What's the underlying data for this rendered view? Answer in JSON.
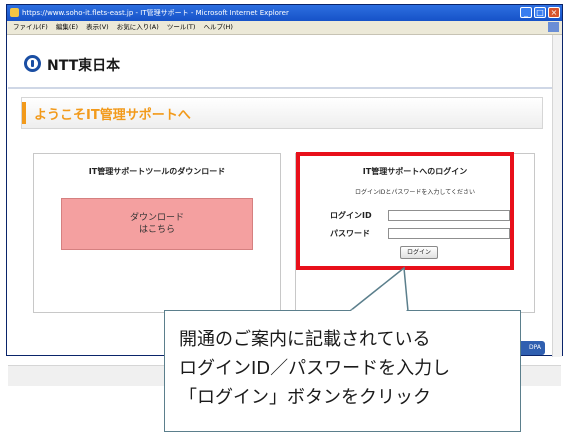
{
  "window": {
    "title": "https://www.soho-it.flets-east.jp - IT管理サポート - Microsoft Internet Explorer",
    "menu": [
      "ファイル(F)",
      "編集(E)",
      "表示(V)",
      "お気に入り(A)",
      "ツール(T)",
      "ヘルプ(H)"
    ]
  },
  "brand": {
    "name": "NTT東日本"
  },
  "welcome": {
    "text": "ようこそIT管理サポートへ"
  },
  "download_panel": {
    "title": "IT管理サポートツールのダウンロード",
    "button": "ダウンロード\nはこちら"
  },
  "login_panel": {
    "title": "IT管理サポートへのログイン",
    "note": "ログインIDとパスワードを入力してください",
    "id_label": "ログインID",
    "password_label": "パスワード",
    "button": "ログイン"
  },
  "blue_button": {
    "label": "DPA"
  },
  "callout": {
    "text": "開通のご案内に記載されている\nログインID／パスワードを入力し\n「ログイン」ボタンをクリック"
  },
  "colors": {
    "highlight": "#e8101a",
    "accent": "#f29a1b",
    "brand": "#1a4ea3"
  }
}
